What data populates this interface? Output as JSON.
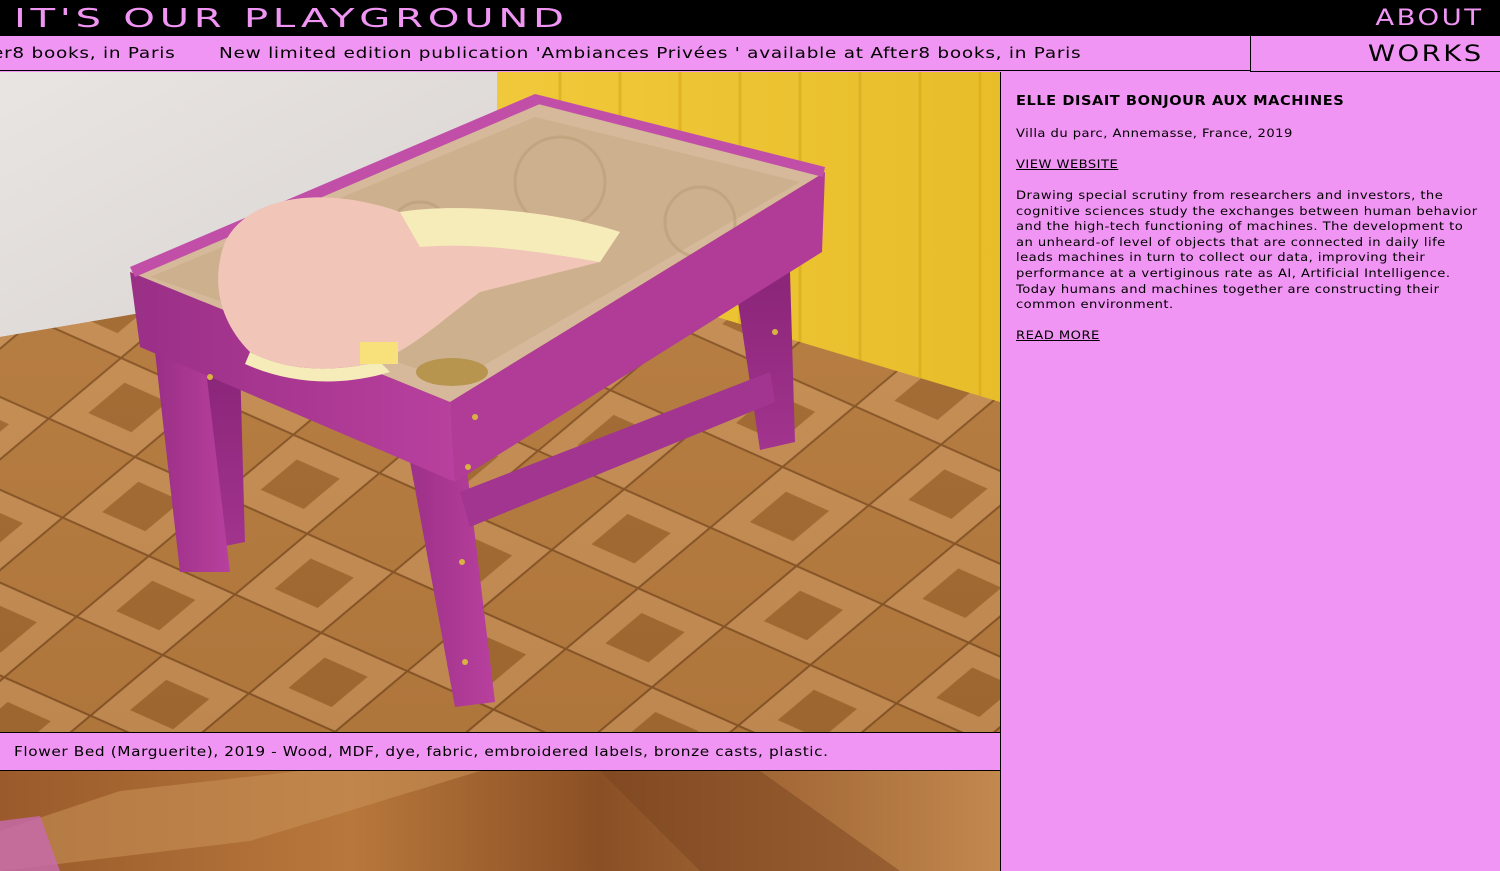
{
  "header": {
    "site_title": "IT'S OUR PLAYGROUND",
    "ticker_items": [
      "er8 books, in Paris",
      "New limited edition publication 'Ambiances Privées ' available at After8 books, in Paris"
    ],
    "nav": {
      "about_label": "ABOUT",
      "works_label": "WORKS"
    }
  },
  "artwork": {
    "caption": "Flower Bed (Marguerite), 2019 - Wood, MDF, dye, fabric, embroidered labels, bronze casts, plastic."
  },
  "info": {
    "title": "ELLE DISAIT BONJOUR AUX MACHINES",
    "location": "Villa du parc, Annemasse, France, 2019",
    "view_website_label": "VIEW WEBSITE",
    "description": "Drawing special scrutiny from researchers and investors, the cognitive sciences study the exchanges between human behavior and the high-tech functioning of machines. The development to an unheard-of level of objects that are connected in daily life leads machines in turn to collect our data, improving their performance at a vertiginous rate as AI, Artificial Intelligence. Today humans and machines together are constructing their common environment.",
    "read_more_label": "READ MORE"
  },
  "colors": {
    "accent_pink": "#f195f4",
    "black": "#000000"
  }
}
